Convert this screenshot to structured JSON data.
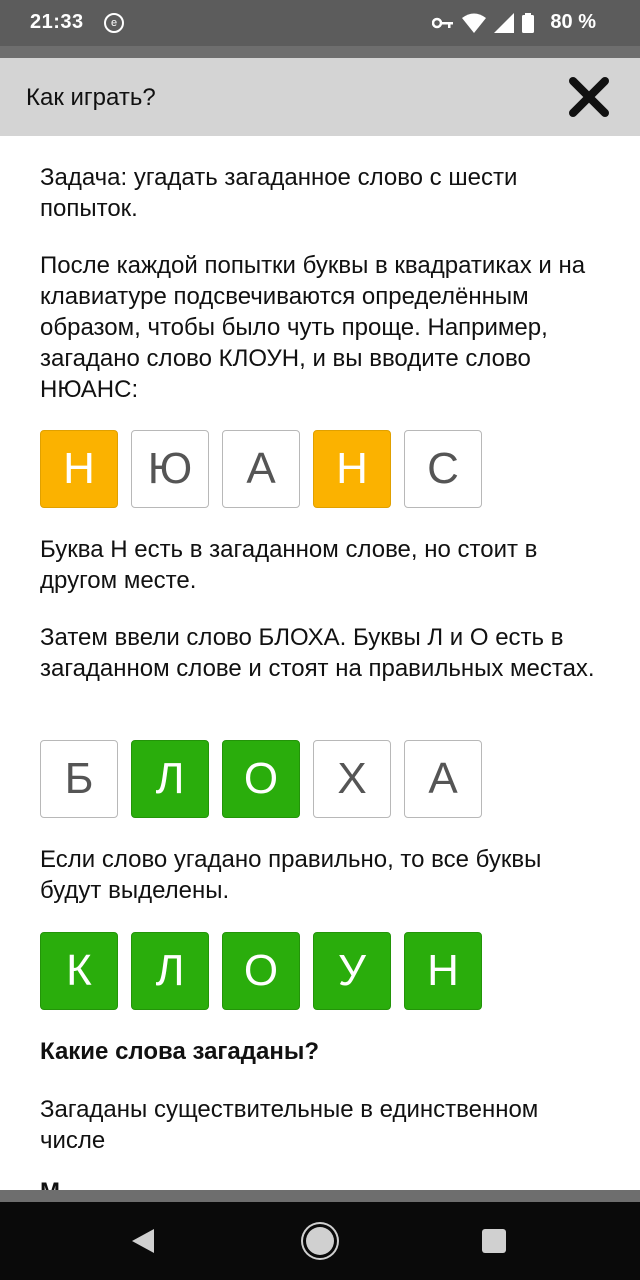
{
  "status_bar": {
    "time": "21:33",
    "battery": "80 %"
  },
  "header": {
    "title": "Как играть?"
  },
  "content": {
    "p1": "Задача: угадать загаданное слово с шести попыток.",
    "p2": "После каждой попытки буквы в квадратиках и на клавиатуре подсвечиваются определённым образом, чтобы было чуть проще. Например, загадано слово КЛОУН, и вы вводите слово НЮАНС:",
    "row1": [
      {
        "letter": "Н",
        "state": "yellow"
      },
      {
        "letter": "Ю",
        "state": "empty"
      },
      {
        "letter": "А",
        "state": "empty"
      },
      {
        "letter": "Н",
        "state": "yellow"
      },
      {
        "letter": "С",
        "state": "empty"
      }
    ],
    "p3": "Буква Н есть в загаданном слове, но стоит в другом месте.",
    "p4": "Затем ввели слово БЛОХА. Буквы Л и О есть в загаданном слове и стоят на правильных местах.",
    "row2": [
      {
        "letter": "Б",
        "state": "empty"
      },
      {
        "letter": "Л",
        "state": "green"
      },
      {
        "letter": "О",
        "state": "green"
      },
      {
        "letter": "Х",
        "state": "empty"
      },
      {
        "letter": "А",
        "state": "empty"
      }
    ],
    "p5": "Если слово угадано правильно, то все буквы будут выделены.",
    "row3": [
      {
        "letter": "К",
        "state": "green"
      },
      {
        "letter": "Л",
        "state": "green"
      },
      {
        "letter": "О",
        "state": "green"
      },
      {
        "letter": "У",
        "state": "green"
      },
      {
        "letter": "Н",
        "state": "green"
      }
    ],
    "h1": "Какие слова загаданы?",
    "p6": "Загаданы существительные в единственном числе",
    "cut": "М"
  },
  "colors": {
    "yellow": "#fbb200",
    "green": "#2aad0c",
    "header_bg": "#d4d4d4"
  },
  "icons": {
    "close": "close-icon",
    "nav_back": "back-triangle-icon",
    "nav_home": "home-circle-icon",
    "nav_recent": "recents-square-icon"
  }
}
